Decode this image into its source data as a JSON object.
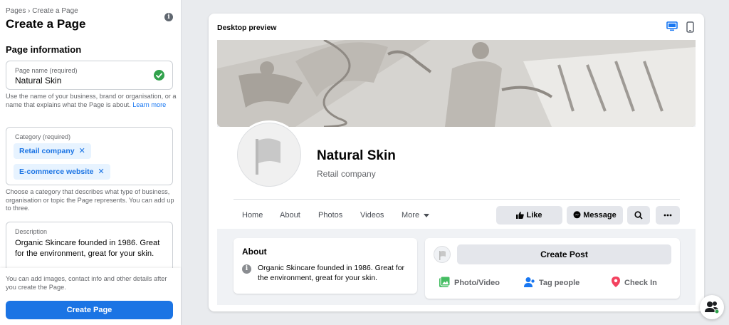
{
  "left_panel": {
    "breadcrumb": "Pages › Create a Page",
    "title": "Create a Page",
    "info_icon": "info-icon",
    "section_title": "Page information",
    "page_name": {
      "label": "Page name (required)",
      "value": "Natural Skin",
      "status_icon": "check-circle-icon"
    },
    "name_help": "Use the name of your business, brand or organisation, or a name that explains what the Page is about.",
    "name_help_link": "Learn more",
    "category": {
      "label": "Category (required)",
      "chips": [
        "Retail company",
        "E-commerce website"
      ],
      "remove_glyph": "✕"
    },
    "category_help": "Choose a category that describes what type of business, organisation or topic the Page represents. You can add up to three.",
    "description": {
      "label": "Description",
      "value": "Organic Skincare founded in 1986. Great for the environment, great for your skin."
    },
    "bottom_note": "You can add images, contact info and other details after you create the Page.",
    "create_button": "Create Page"
  },
  "preview": {
    "title": "Desktop preview",
    "desktop_icon": "desktop-icon",
    "mobile_icon": "mobile-icon",
    "accent": "#1877f2",
    "page_name": "Natural Skin",
    "page_category": "Retail company",
    "nav": [
      "Home",
      "About",
      "Photos",
      "Videos",
      "More"
    ],
    "actions": {
      "like": "Like",
      "message": "Message"
    },
    "about": {
      "title": "About",
      "text": "Organic Skincare founded in 1986. Great for the environment, great for your skin."
    },
    "post": {
      "create_label": "Create Post",
      "photo_video": "Photo/Video",
      "tag_people": "Tag people",
      "check_in": "Check In"
    }
  }
}
